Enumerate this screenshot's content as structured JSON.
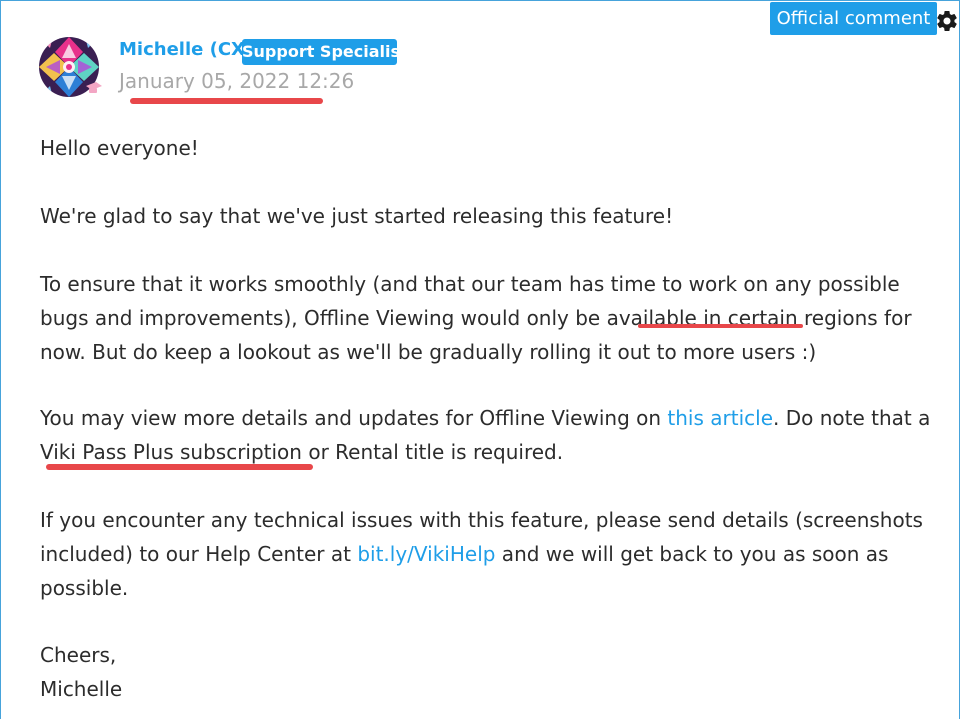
{
  "header": {
    "official_badge": "Official comment",
    "author": "Michelle (CX)",
    "role": "Support Specialist",
    "timestamp": "January 05, 2022 12:26"
  },
  "body": {
    "greeting": "Hello everyone!",
    "p1": "We're glad to say that we've just started releasing this feature!",
    "p2_a": "To ensure that it works smoothly (and that our team has time to work on any possible bugs and improvements), Offline Viewing would only be available ",
    "p2_highlight": "in certain regions",
    "p2_b": " for now. But do keep a lookout as we'll be gradually rolling it out to more users :)",
    "p3_a": "You may view more details and updates for Offline Viewing on ",
    "p3_link": "this article",
    "p3_b": ". Do note that a ",
    "p3_highlight": "Viki Pass Plus subscription",
    "p3_c": " or Rental title is required.",
    "p4_a": "If you encounter any technical issues with this feature, please send details (screenshots included) to our Help Center at ",
    "p4_link": "bit.ly/VikiHelp",
    "p4_b": " and we will get back to you as soon as possible.",
    "signoff": "Cheers,",
    "signature": "Michelle"
  },
  "colors": {
    "accent": "#1f9ee8",
    "border": "#46a3db",
    "highlight_underline": "#e8474a",
    "timestamp": "#a8a8a8",
    "text": "#2c2c2c"
  },
  "icons": {
    "settings": "gear-icon",
    "avatar_badge": "graduation-cap-icon"
  }
}
